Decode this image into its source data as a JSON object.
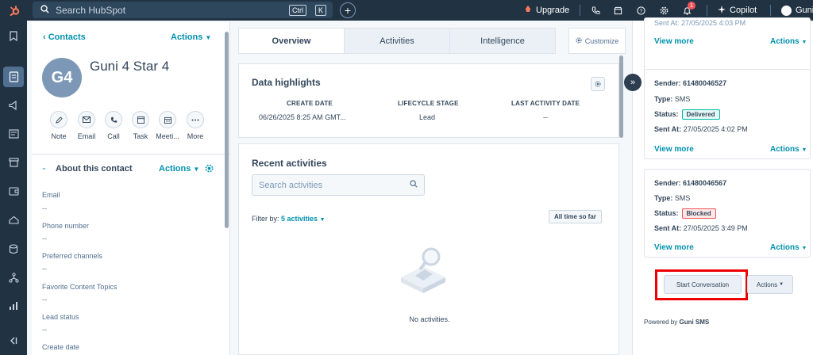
{
  "topbar": {
    "search_placeholder": "Search HubSpot",
    "kbd_ctrl": "Ctrl",
    "kbd_k": "K",
    "upgrade": "Upgrade",
    "notif_count": "1",
    "copilot": "Copilot",
    "user": "Guni"
  },
  "contact": {
    "back_label": "Contacts",
    "actions_label": "Actions",
    "initials": "G4",
    "name": "Guni 4 Star 4",
    "quick_actions": [
      "Note",
      "Email",
      "Call",
      "Task",
      "Meeti...",
      "More"
    ]
  },
  "about": {
    "title": "About this contact",
    "actions_label": "Actions",
    "properties": [
      {
        "label": "Email",
        "value": "--"
      },
      {
        "label": "Phone number",
        "value": "--"
      },
      {
        "label": "Preferred channels",
        "value": "--"
      },
      {
        "label": "Favorite Content Topics",
        "value": "--"
      },
      {
        "label": "Lead status",
        "value": "--"
      },
      {
        "label": "Create date",
        "value": ""
      }
    ]
  },
  "tabs": [
    "Overview",
    "Activities",
    "Intelligence"
  ],
  "customize_label": "Customize",
  "highlights": {
    "title": "Data highlights",
    "columns": [
      {
        "header": "CREATE DATE",
        "value": "06/26/2025 8:25 AM GMT..."
      },
      {
        "header": "LIFECYCLE STAGE",
        "value": "Lead"
      },
      {
        "header": "LAST ACTIVITY DATE",
        "value": "--"
      }
    ]
  },
  "recent": {
    "title": "Recent activities",
    "search_placeholder": "Search activities",
    "filter_prefix": "Filter by:",
    "filter_value": "5 activities",
    "time_filter": "All time so far",
    "empty_text": "No activities."
  },
  "messages": {
    "top_partial": "Sent At: 27/05/2025 4:03 PM",
    "top_view_more": "View more",
    "top_actions": "Actions",
    "items": [
      {
        "sender_label": "Sender:",
        "sender": "61480046527",
        "type_label": "Type:",
        "type": "SMS",
        "status_label": "Status:",
        "status": "Delivered",
        "sent_label": "Sent At:",
        "sent_at": "27/05/2025 4:02 PM",
        "view_more": "View more",
        "actions": "Actions"
      },
      {
        "sender_label": "Sender:",
        "sender": "61480046567",
        "type_label": "Type:",
        "type": "SMS",
        "status_label": "Status:",
        "status": "Blocked",
        "sent_label": "Sent At:",
        "sent_at": "27/05/2025 3:49 PM",
        "view_more": "View more",
        "actions": "Actions"
      }
    ],
    "start_conversation": "Start Conversation",
    "actions_button": "Actions",
    "powered_prefix": "Powered by",
    "powered_brand": "Guni SMS"
  },
  "colors": {
    "brand_dark": "#213343",
    "link": "#0091ae",
    "delivered": "#00bda5",
    "blocked": "#f2545b",
    "highlight_box": "#ee0000"
  }
}
